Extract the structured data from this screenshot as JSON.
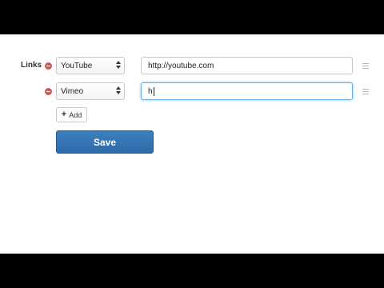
{
  "form": {
    "links_label": "Links",
    "rows": [
      {
        "service": "YouTube",
        "url": "http://youtube.com"
      },
      {
        "service": "Vimeo",
        "url": "h"
      }
    ],
    "add_label": "Add",
    "save_label": "Save"
  },
  "icons": {
    "remove": "minus-circle-icon",
    "add": "plus-icon",
    "drag": "drag-handle-icon",
    "select_caret": "up-down-caret-icon"
  },
  "colors": {
    "remove_red": "#d9534f",
    "save_blue": "#3071a9",
    "focus_blue": "#66afe9"
  }
}
